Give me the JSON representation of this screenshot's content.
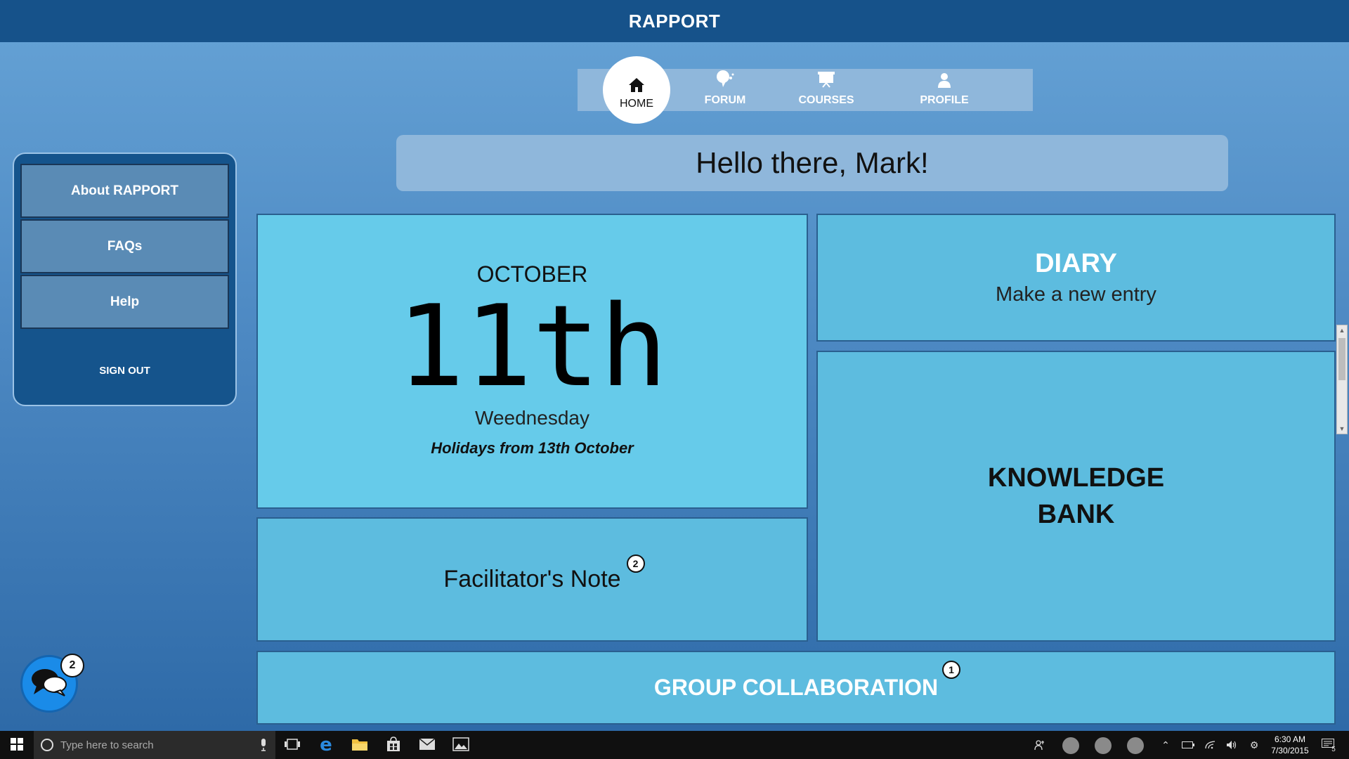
{
  "app": {
    "title": "RAPPORT"
  },
  "nav": {
    "home": "HOME",
    "forum": "FORUM",
    "courses": "COURSES",
    "profile": "PROFILE",
    "active": "HOME"
  },
  "greeting": "Hello there, Mark!",
  "sidebar": {
    "items": [
      {
        "label": "About RAPPORT"
      },
      {
        "label": "FAQs"
      },
      {
        "label": "Help"
      }
    ],
    "signout": "SIGN OUT"
  },
  "date_tile": {
    "month": "OCTOBER",
    "day": "11th",
    "weekday": "Weednesday",
    "note": "Holidays from 13th October"
  },
  "diary": {
    "title": "DIARY",
    "subtitle": "Make a new entry"
  },
  "knowledge_bank": {
    "title": "KNOWLEDGE BANK"
  },
  "facilitator_note": {
    "label": "Facilitator's Note",
    "badge": "2"
  },
  "group_collaboration": {
    "label": "GROUP COLLABORATION",
    "badge": "1"
  },
  "chat": {
    "badge": "2"
  },
  "taskbar": {
    "search_placeholder": "Type here to search",
    "time": "6:30 AM",
    "date": "7/30/2015",
    "notifications": "5"
  },
  "colors": {
    "title_bar": "#16528a",
    "nav_bar": "#8fb7db",
    "date_tile": "#66cbea",
    "tile": "#5dbcdf",
    "sidebar": "#15548c",
    "chat_button": "#1a8be8"
  }
}
